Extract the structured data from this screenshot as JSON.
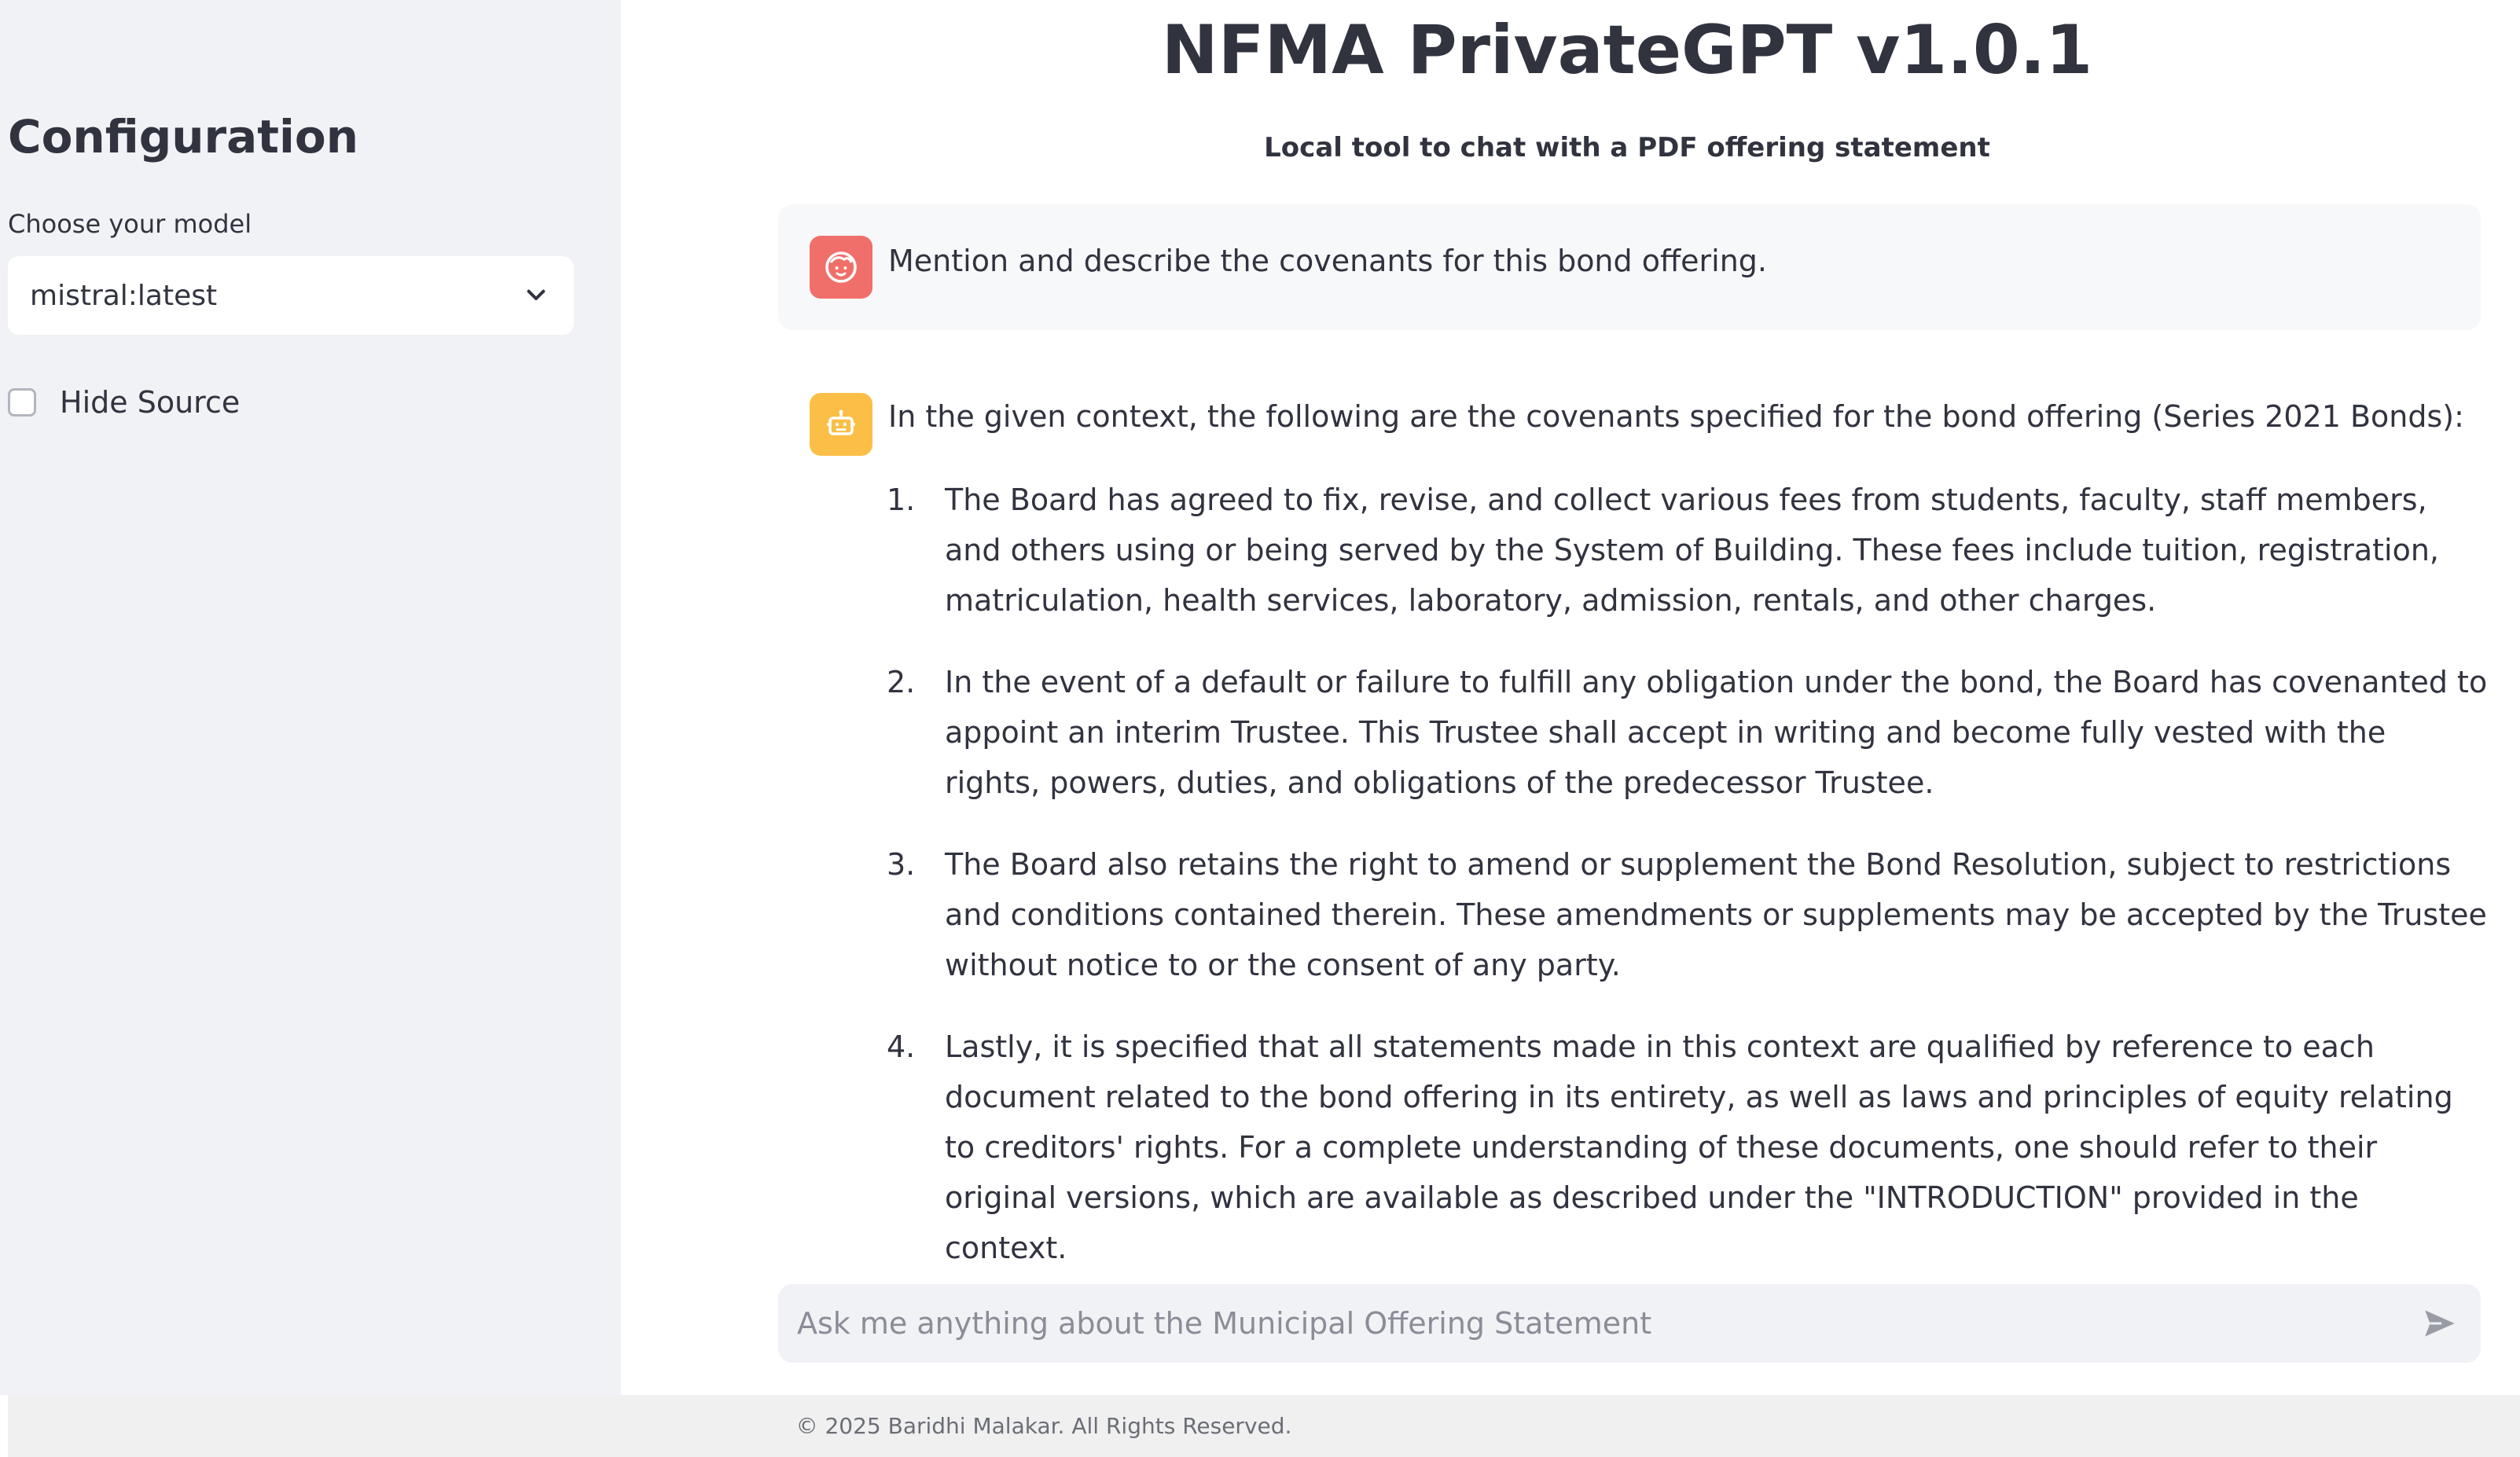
{
  "sidebar": {
    "title": "Configuration",
    "model_label": "Choose your model",
    "model_selected": "mistral:latest",
    "hide_source_label": "Hide Source"
  },
  "main": {
    "title": "NFMA PrivateGPT v1.0.1",
    "subtitle": "Local tool to chat with a PDF offering statement",
    "user_message": "Mention and describe the covenants for this bond offering.",
    "assistant_intro": "In the given context, the following are the covenants specified for the bond offering (Series 2021 Bonds):",
    "assistant_points": [
      {
        "num": "1.",
        "text": "The Board has agreed to fix, revise, and collect various fees from students, faculty, staff members, and others using or being served by the System of Building. These fees include tuition, registration, matriculation, health services, laboratory, admission, rentals, and other charges."
      },
      {
        "num": "2.",
        "text": "In the event of a default or failure to fulfill any obligation under the bond, the Board has covenanted to appoint an interim Trustee. This Trustee shall accept in writing and become fully vested with the rights, powers, duties, and obligations of the predecessor Trustee."
      },
      {
        "num": "3.",
        "text": "The Board also retains the right to amend or supplement the Bond Resolution, subject to restrictions and conditions contained therein. These amendments or supplements may be accepted by the Trustee without notice to or the consent of any party."
      },
      {
        "num": "4.",
        "text": "Lastly, it is specified that all statements made in this context are qualified by reference to each document related to the bond offering in its entirety, as well as laws and principles of equity relating to creditors' rights. For a complete understanding of these documents, one should refer to their original versions, which are available as described under the \"INTRODUCTION\" provided in the context."
      }
    ],
    "chat_placeholder": "Ask me anything about the Municipal Offering Statement"
  },
  "footer": {
    "text": "© 2025 Baridhi Malakar. All Rights Reserved."
  },
  "icons": {
    "user_avatar": "user-face-icon",
    "bot_avatar": "robot-icon",
    "dropdown": "chevron-down-icon",
    "send": "send-icon"
  },
  "colors": {
    "user_avatar_bg": "#f06f6a",
    "bot_avatar_bg": "#fbbf47",
    "sidebar_bg": "#f0f2f6"
  }
}
